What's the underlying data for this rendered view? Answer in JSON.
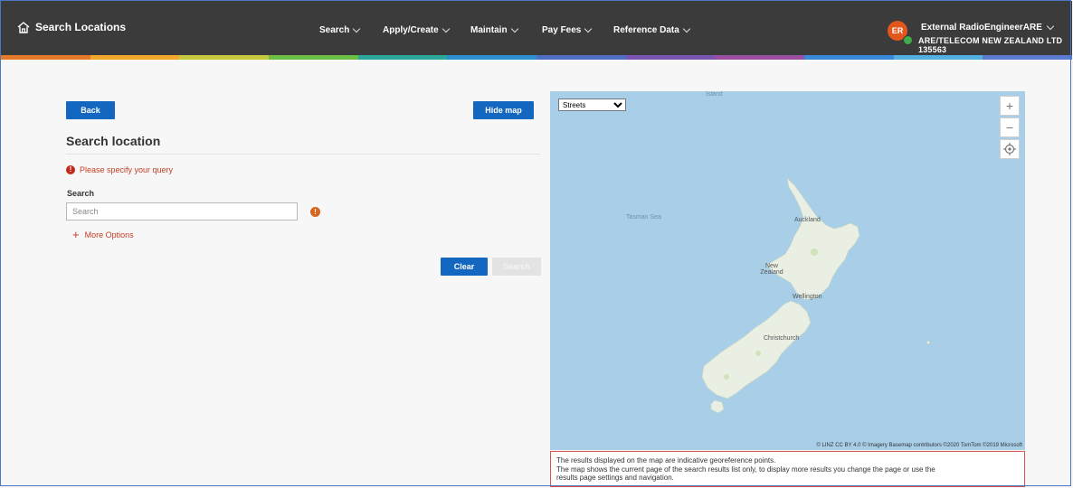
{
  "header": {
    "title": "Search Locations",
    "nav": [
      {
        "label": "Search"
      },
      {
        "label": "Apply/Create"
      },
      {
        "label": "Maintain"
      },
      {
        "label": "Pay Fees"
      },
      {
        "label": "Reference Data"
      }
    ],
    "user": {
      "initials": "ER",
      "name": "External RadioEngineerARE",
      "org": "ARE/TELECOM NEW ZEALAND LTD 135563",
      "avatar_color": "#e2571e",
      "status_color": "#3fae49"
    },
    "bar_color": "#3b3b3b"
  },
  "colors": {
    "primary_button": "#1367c0",
    "error": "#c53c24",
    "strip": [
      "#e57a2a",
      "#f0a72a",
      "#c6c93d",
      "#6dbe45",
      "#2aa89a",
      "#2c8fcf",
      "#4f6fc4",
      "#7a55b3",
      "#9b4fa3",
      "#3a88d8",
      "#52b0e0",
      "#5b7bd0"
    ]
  },
  "left": {
    "back_label": "Back",
    "hide_map_label": "Hide map",
    "heading": "Search location",
    "error_text": "Please specify your query",
    "search_label": "Search",
    "search_placeholder": "Search",
    "search_value": "",
    "more_options_label": "More Options",
    "clear_label": "Clear",
    "search_button_label": "Search"
  },
  "map": {
    "layer_options": [
      "Streets"
    ],
    "layer_selected": "Streets",
    "zoom_in": "+",
    "zoom_out": "−",
    "locate_icon": "crosshair-icon",
    "labels": {
      "island": "Island",
      "sea": "Tasman Sea",
      "country": "New Zealand",
      "auckland": "Auckland",
      "wellington": "Wellington",
      "christchurch": "Christchurch"
    },
    "attribution": "© LINZ CC BY 4.0 © Imagery Basemap contributors ©2020 TomTom ©2019 Microsoft",
    "water_color": "#a8cee8",
    "land_color": "#e9efe3"
  },
  "notice": {
    "line1": "The results displayed on the map are indicative georeference points.",
    "line2": "The map shows the current page of the search results list only, to display more results you change the page or use the",
    "line3": "results page settings and navigation."
  }
}
